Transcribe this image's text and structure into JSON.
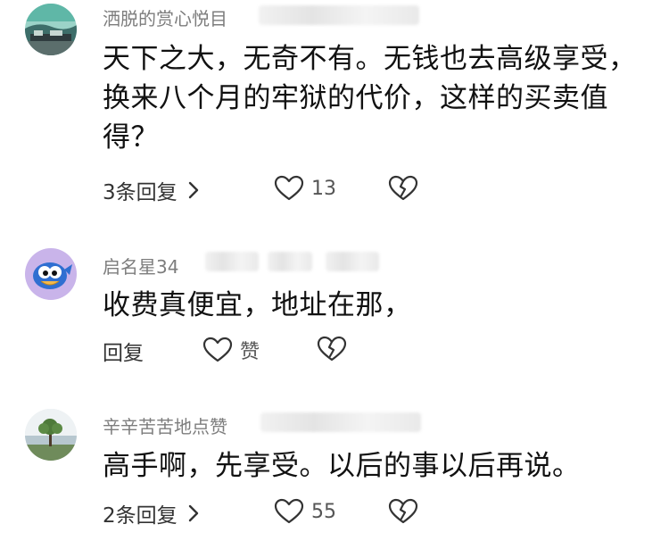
{
  "comments": [
    {
      "username": "洒脱的赏心悦目",
      "text": "天下之大，无奇不有。无钱也去高级享受，换来八个月的牢狱的代价，这样的买卖值得？",
      "reply_label": "3条回复",
      "like_count": "13"
    },
    {
      "username": "启名星34",
      "text": "收费真便宜，地址在那，",
      "reply_label": "回复",
      "like_count": "赞"
    },
    {
      "username": "辛辛苦苦地点赞",
      "text": "高手啊，先享受。以后的事以后再说。",
      "reply_label": "2条回复",
      "like_count": "55"
    }
  ],
  "icons": {
    "like": "heart-outline-icon",
    "dislike": "broken-heart-icon",
    "expand": "chevron-right-icon"
  },
  "colors": {
    "username": "#7d7d7d",
    "text": "#111111",
    "icon": "#333333"
  }
}
